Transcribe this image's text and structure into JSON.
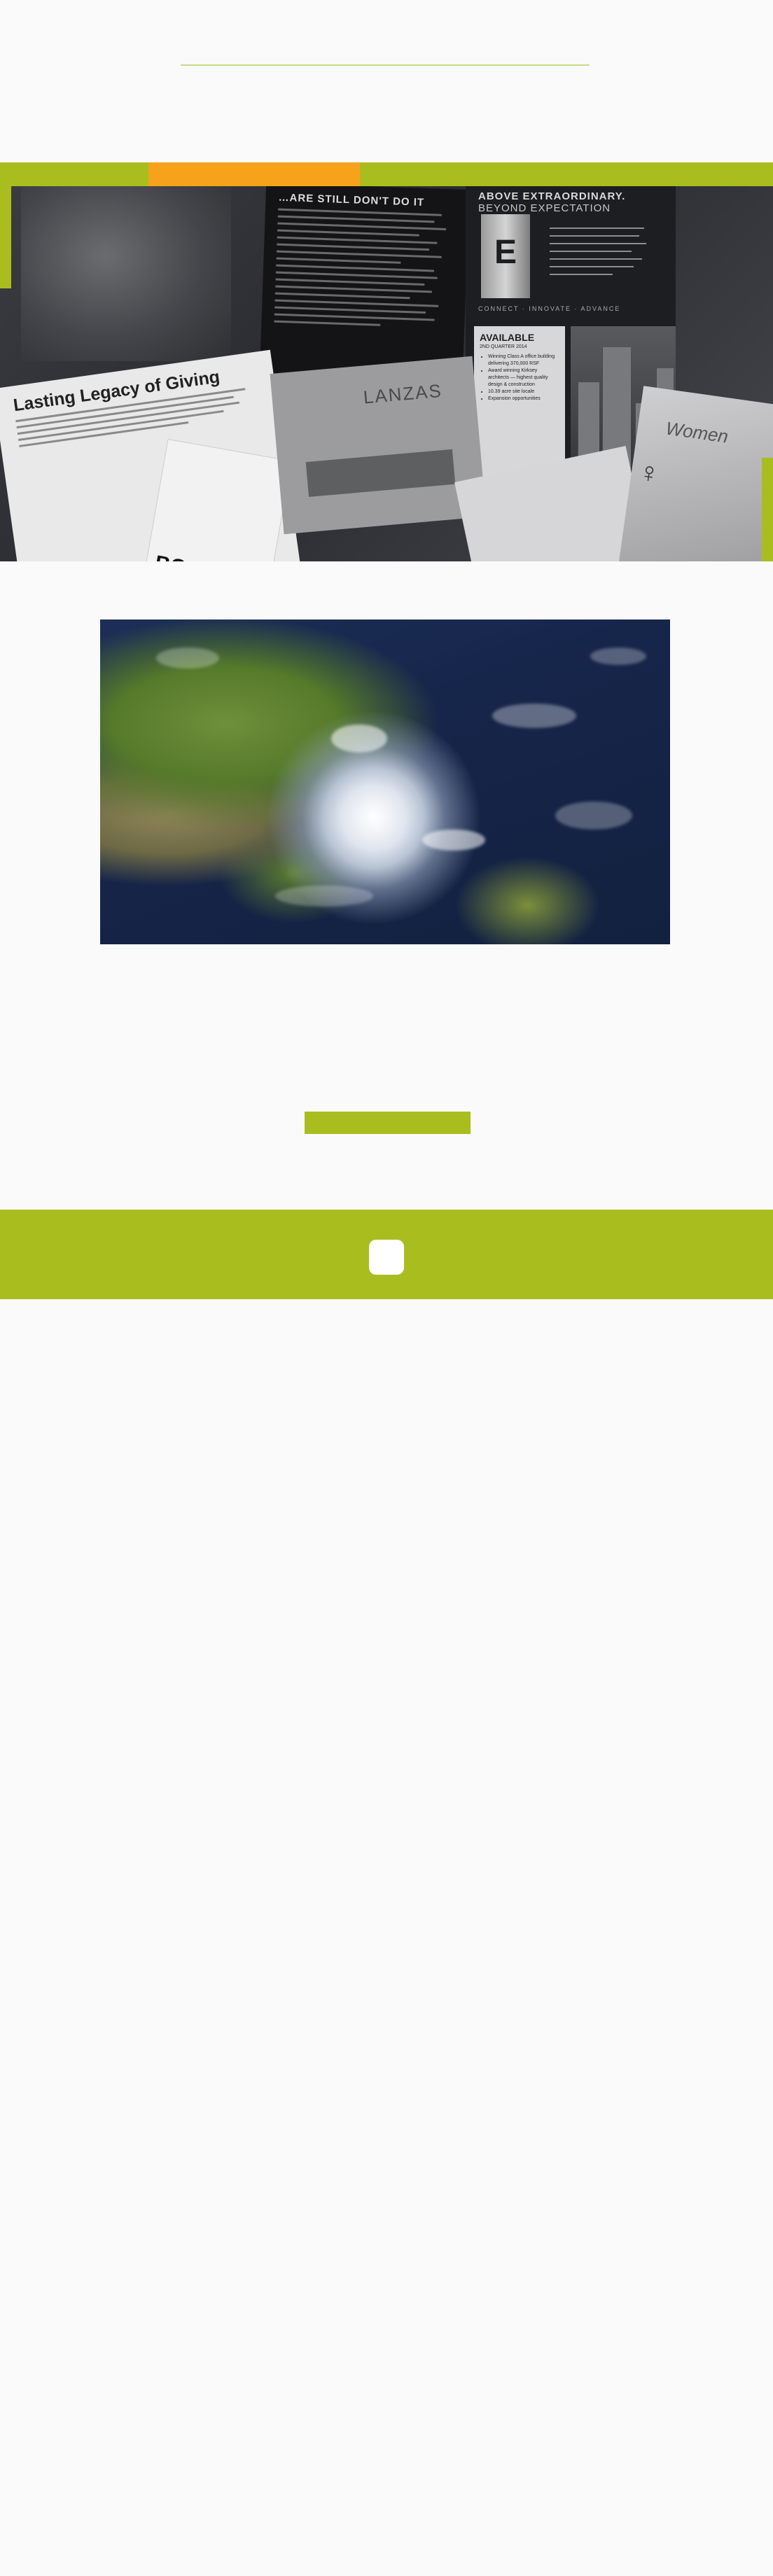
{
  "collage": {
    "dark_doc_heading": "…ARE STILL DON'T DO IT",
    "energy_heading": "ABOVE EXTRAORDINARY.",
    "energy_subheading": "BEYOND EXPECTATION",
    "energy_logo_letter": "E",
    "energy_tagline": "CONNECT · INNOVATE · ADVANCE",
    "available_title": "AVAILABLE",
    "available_sub": "2ND QUARTER 2014",
    "available_items": [
      "Winning Class A office building delivering 370,000 RSF",
      "Award winning Kirksey architects — highest quality design & construction",
      "10.39 acre site locale",
      "Expansion opportunities"
    ],
    "giving_title": "Lasting Legacy of Giving",
    "book_title": "BOOK",
    "horse_title": "LANZAS",
    "woman_title": "Women"
  },
  "hurricane_image": {
    "description_label": "hurricane satellite image"
  },
  "colors": {
    "accent_green": "#a9be1e",
    "accent_orange": "#f7a21b"
  },
  "button": {
    "label": ""
  }
}
